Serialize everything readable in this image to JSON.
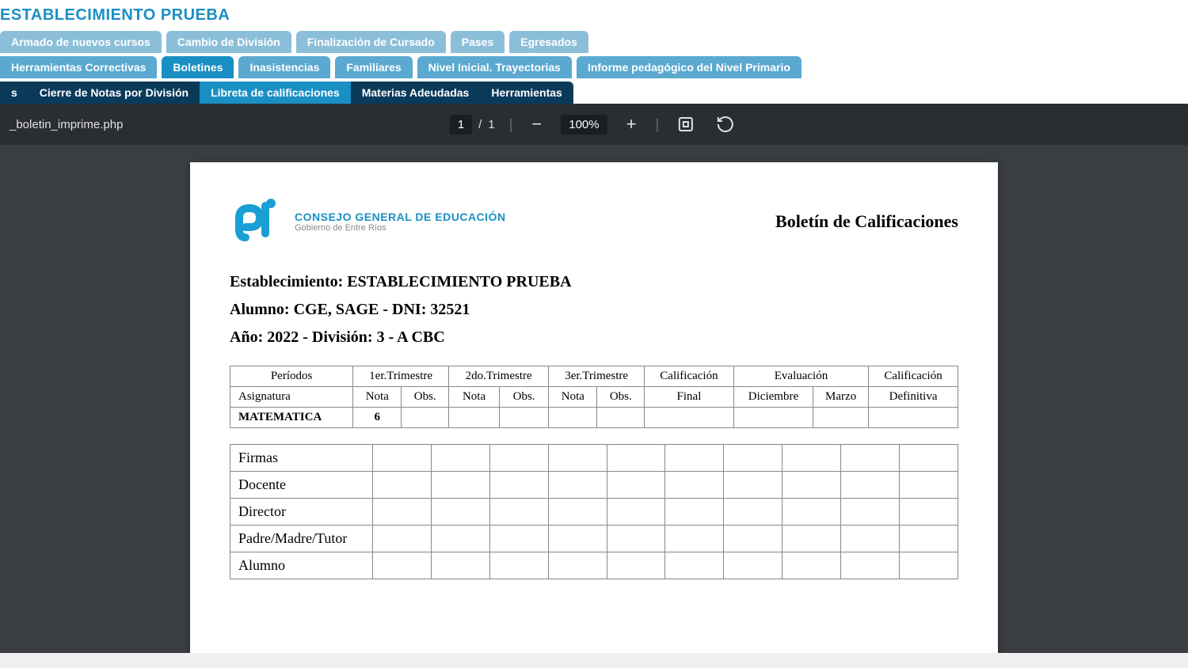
{
  "header": {
    "title": "ESTABLECIMIENTO PRUEBA"
  },
  "tabs_row1": [
    "Armado de nuevos cursos",
    "Cambio de División",
    "Finalización de Cursado",
    "Pases",
    "Egresados"
  ],
  "tabs_row2": [
    "Herramientas Correctivas",
    "Boletines",
    "Inasistencias",
    "Familiares",
    "Nivel Inicial. Trayectorias",
    "Informe pedagógico del Nivel Primario"
  ],
  "tabs_row3": [
    "Cierre de Notas por División",
    "Libreta de calificaciones",
    "Materias Adeudadas",
    "Herramientas"
  ],
  "pdf": {
    "filename": "_boletin_imprime.php",
    "page_current": "1",
    "page_sep": "/",
    "page_total": "1",
    "zoom": "100%"
  },
  "doc": {
    "logo_line1": "CONSEJO GENERAL DE EDUCACIÓN",
    "logo_line2": "Gobierno de Entre Ríos",
    "title": "Boletín de Calificaciones",
    "establishment": "Establecimiento: ESTABLECIMIENTO PRUEBA",
    "student": "Alumno: CGE, SAGE - DNI: 32521",
    "year_division": "Año: 2022 - División: 3 - A CBC",
    "table": {
      "periods": "Períodos",
      "t1": "1er.Trimestre",
      "t2": "2do.Trimestre",
      "t3": "3er.Trimestre",
      "calif": "Calificación",
      "eval": "Evaluación",
      "calif2": "Calificación",
      "subject": "Asignatura",
      "nota": "Nota",
      "obs": "Obs.",
      "final": "Final",
      "dic": "Diciembre",
      "marzo": "Marzo",
      "def": "Definitiva",
      "row_subject": "MATEMATICA",
      "row_t1_nota": "6"
    },
    "signatures": {
      "firmas": "Firmas",
      "docente": "Docente",
      "director": "Director",
      "tutor": "Padre/Madre/Tutor",
      "alumno": "Alumno"
    }
  }
}
